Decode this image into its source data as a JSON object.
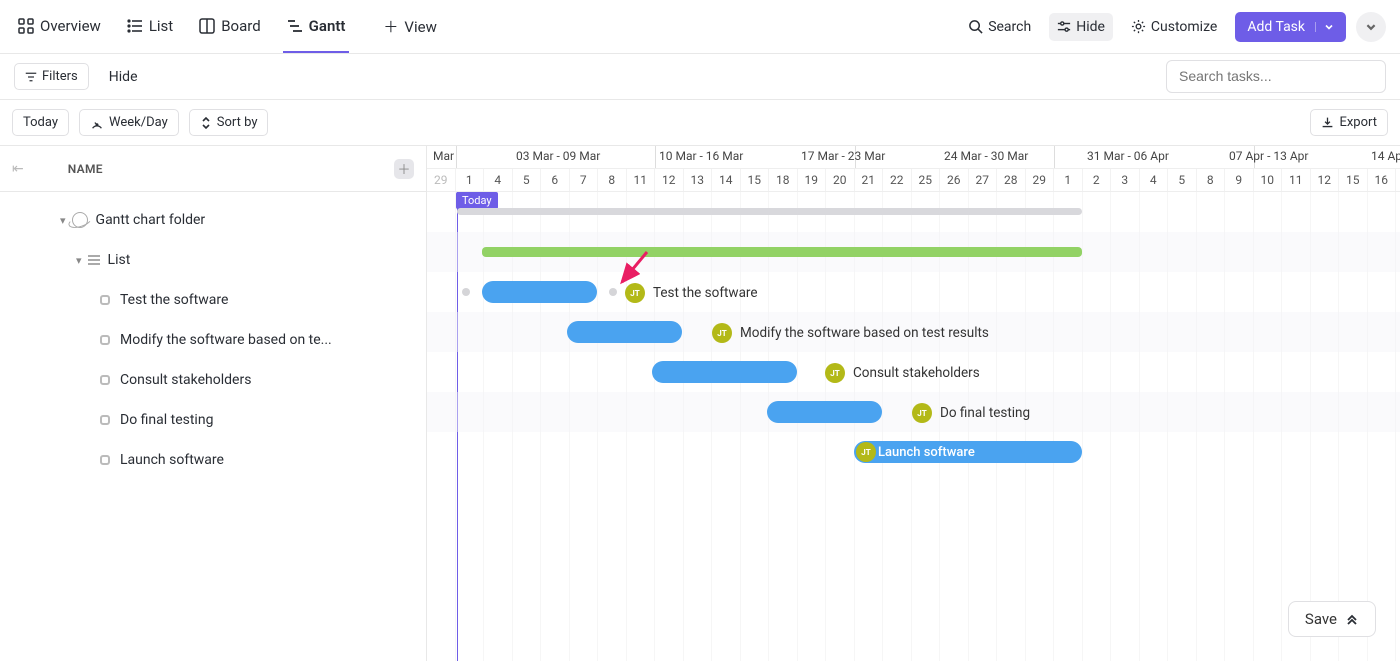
{
  "tabs": {
    "overview": "Overview",
    "list": "List",
    "board": "Board",
    "gantt": "Gantt",
    "addview": "View"
  },
  "actions": {
    "search": "Search",
    "hide": "Hide",
    "customize": "Customize",
    "add_task": "Add Task"
  },
  "subbar": {
    "filters": "Filters",
    "hide": "Hide",
    "search_placeholder": "Search tasks..."
  },
  "toolbar": {
    "today": "Today",
    "timescale": "Week/Day",
    "sort": "Sort by",
    "export": "Export"
  },
  "sidebar": {
    "name_header": "NAME",
    "folder": "Gantt chart folder",
    "list": "List",
    "tasks": [
      "Test the software",
      "Modify the software based on te...",
      "Consult stakeholders",
      "Do final testing",
      "Launch software"
    ]
  },
  "timeline": {
    "mar_label": "Mar",
    "week_labels": [
      "03 Mar - 09 Mar",
      "10 Mar - 16 Mar",
      "17 Mar - 23 Mar",
      "24 Mar - 30 Mar",
      "31 Mar - 06 Apr",
      "07 Apr - 13 Apr",
      "14 Ap"
    ],
    "today": "Today",
    "bar_labels": {
      "test": "Test the software",
      "modify": "Modify the software based on test results",
      "consult": "Consult stakeholders",
      "final": "Do final testing",
      "launch": "Launch software"
    },
    "assignee_initials": "JT"
  },
  "footer": {
    "save": "Save"
  }
}
